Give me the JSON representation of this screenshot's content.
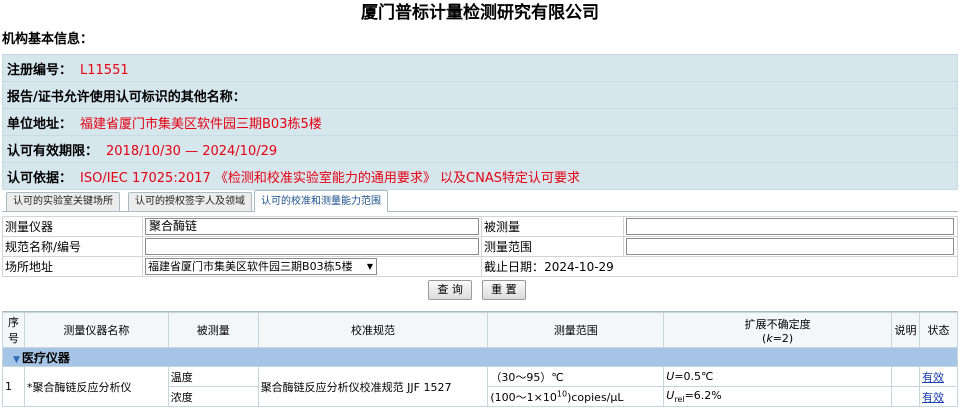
{
  "page": {
    "title": "厦门普标计量检测研究有限公司",
    "section_title": "机构基本信息："
  },
  "info": [
    {
      "label": "注册编号：",
      "value": "L11551"
    },
    {
      "label": "报告/证书允许使用认可标识的其他名称：",
      "value": ""
    },
    {
      "label": "单位地址：",
      "value": "福建省厦门市集美区软件园三期B03栋5楼"
    },
    {
      "label": "认可有效期限：",
      "value": "2018/10/30 — 2024/10/29"
    },
    {
      "label": "认可依据：",
      "value": "ISO/IEC 17025:2017 《检测和校准实验室能力的通用要求》 以及CNAS特定认可要求"
    }
  ],
  "tabs": [
    {
      "label": "认可的实验室关键场所"
    },
    {
      "label": "认可的授权签字人及领域"
    },
    {
      "label": "认可的校准和测量能力范围"
    }
  ],
  "filter": {
    "instrument_label": "测量仪器",
    "instrument_value": "聚合酶链",
    "measurand_label": "被测量",
    "measurand_value": "",
    "spec_label": "规范名称/编号",
    "spec_value": "",
    "range_label": "测量范围",
    "range_value": "",
    "site_label": "场所地址",
    "site_value": "福建省厦门市集美区软件园三期B03栋5楼",
    "deadline_label": "截止日期：",
    "deadline_value": "2024-10-29",
    "query_button": "查 询",
    "reset_button": "重 置"
  },
  "results": {
    "headers": {
      "no": "序号",
      "name": "测量仪器名称",
      "measurand": "被测量",
      "spec": "校准规范",
      "range": "测量范围",
      "uncertainty": "扩展不确定度",
      "uncertainty_k_prefix": "(",
      "uncertainty_k": "k",
      "uncertainty_k_suffix": "=2)",
      "note": "说明",
      "status": "状态"
    },
    "group": "医疗仪器",
    "row": {
      "no": "1",
      "name": "*聚合酶链反应分析仪",
      "spec": "聚合酶链反应分析仪校准规范 JJF 1527",
      "sub": [
        {
          "measurand": "温度",
          "range": "（30～95）℃",
          "u_sym": "U",
          "u_sub": "",
          "u_val": "=0.5℃",
          "status": "有效"
        },
        {
          "measurand": "浓度",
          "range_pre": "(100～1×10",
          "range_sup": "10",
          "range_post": ")copies/μL",
          "u_sym": "U",
          "u_sub": "rel",
          "u_val": "=6.2%",
          "status": "有效"
        }
      ]
    }
  }
}
